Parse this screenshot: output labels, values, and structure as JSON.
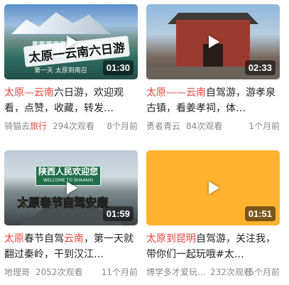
{
  "cards": [
    {
      "thumb_caption": "太原一云南六日游",
      "thumb_subtitle": "第一天 太原到南召",
      "duration": "01:30",
      "title_hl1": "太原",
      "title_sep": "—",
      "title_hl2": "云南",
      "title_rest": "六日游，欢迎观看，点赞，收藏，转发…",
      "author_plain": "骑猫去",
      "author_hl": "旅行",
      "views": "294次观看",
      "time": "8个月前"
    },
    {
      "duration": "02:33",
      "title_hl1": "太原",
      "title_sep": "——",
      "title_hl2": "云南",
      "title_rest": "自驾游，游孝泉古镇，看姜孝祠，体…",
      "author": "勇者青云",
      "views": "84次观看",
      "time": "1个月前"
    },
    {
      "sign_line1": "陕西人民欢迎您",
      "sign_line2": "WELCOME TO SHAANXI",
      "thumb_caption": "太原春节自驾安康",
      "duration": "01:59",
      "title_hl1": "太原",
      "title_mid": "春节自驾",
      "title_hl2": "云南",
      "title_rest": "，第一天就翻过秦岭，干到汉江…",
      "author": "地理哥",
      "views": "2052次观看",
      "time": "11个月前"
    },
    {
      "duration": "01:51",
      "title_hl1": "太原到昆明",
      "title_rest": "自驾游，关注我，带你们一起玩哦#太…",
      "author": "博学多才爱玩…",
      "views": "232次观看",
      "time": "5个月前"
    }
  ],
  "colors": {
    "highlight": "#e8453c",
    "meta": "#888888",
    "title": "#222222"
  },
  "icons": {
    "play": "play-icon"
  }
}
